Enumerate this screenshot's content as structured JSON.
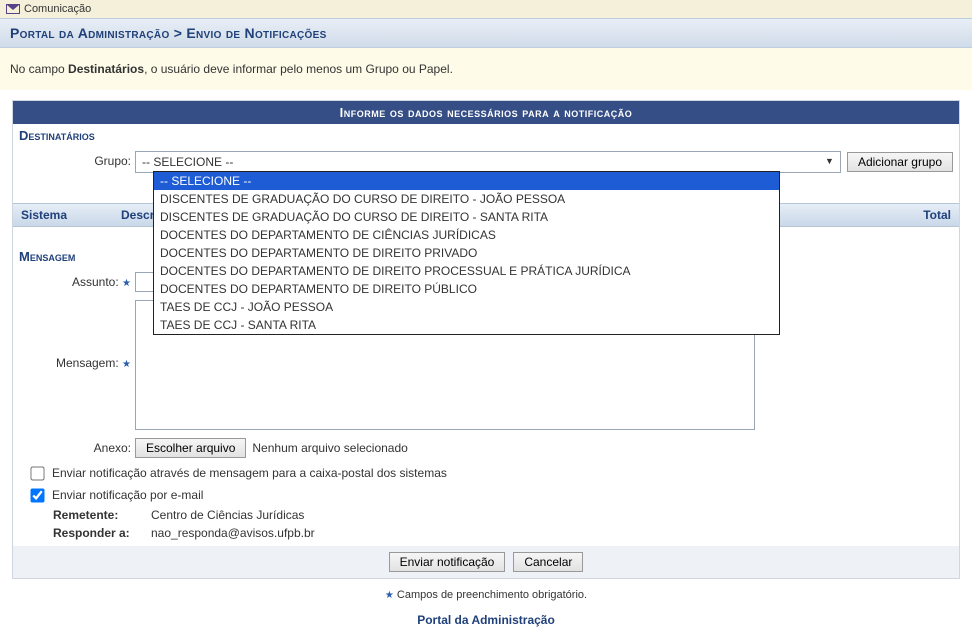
{
  "header": {
    "title": "Comunicação"
  },
  "breadcrumb": {
    "text": "Portal da Administração > Envio de Notificações"
  },
  "hint": {
    "prefix": "No campo ",
    "bold": "Destinatários",
    "suffix": ", o usuário deve informar pelo menos um Grupo ou Papel."
  },
  "form": {
    "title": "Informe os dados necessários para a notificação",
    "destinatarios_header": "Destinatários",
    "grupo_label": "Grupo:",
    "grupo_selected": "-- SELECIONE --",
    "adicionar_grupo": "Adicionar grupo",
    "grupo_options": {
      "o0": "-- SELECIONE --",
      "o1": "DISCENTES DE GRADUAÇÃO DO CURSO DE DIREITO - JOÃO PESSOA",
      "o2": "DISCENTES DE GRADUAÇÃO DO CURSO DE DIREITO - SANTA RITA",
      "o3": "DOCENTES DO DEPARTAMENTO DE CIÊNCIAS JURÍDICAS",
      "o4": "DOCENTES DO DEPARTAMENTO DE DIREITO PRIVADO",
      "o5": "DOCENTES DO DEPARTAMENTO DE DIREITO PROCESSUAL E PRÁTICA JURÍDICA",
      "o6": "DOCENTES DO DEPARTAMENTO DE DIREITO PÚBLICO",
      "o7": "TAES DE CCJ - JOÃO PESSOA",
      "o8": "TAES DE CCJ - SANTA RITA"
    },
    "table": {
      "sistema": "Sistema",
      "descricao": "Descrição",
      "total": "Total"
    },
    "mensagem_header": "Mensagem",
    "assunto_label": "Assunto:",
    "mensagem_label": "Mensagem:",
    "anexo_label": "Anexo:",
    "choose_file": "Escolher arquivo",
    "no_file": "Nenhum arquivo selecionado",
    "chk_caixa": "Enviar notificação através de mensagem para a caixa-postal dos sistemas",
    "chk_email": "Enviar notificação por e-mail",
    "remetente_k": "Remetente:",
    "remetente_v": "Centro de Ciências Jurídicas",
    "responder_k": "Responder a:",
    "responder_v": "nao_responda@avisos.ufpb.br",
    "enviar": "Enviar notificação",
    "cancelar": "Cancelar"
  },
  "required_note": "Campos de preenchimento obrigatório.",
  "footer_link": "Portal da Administração"
}
